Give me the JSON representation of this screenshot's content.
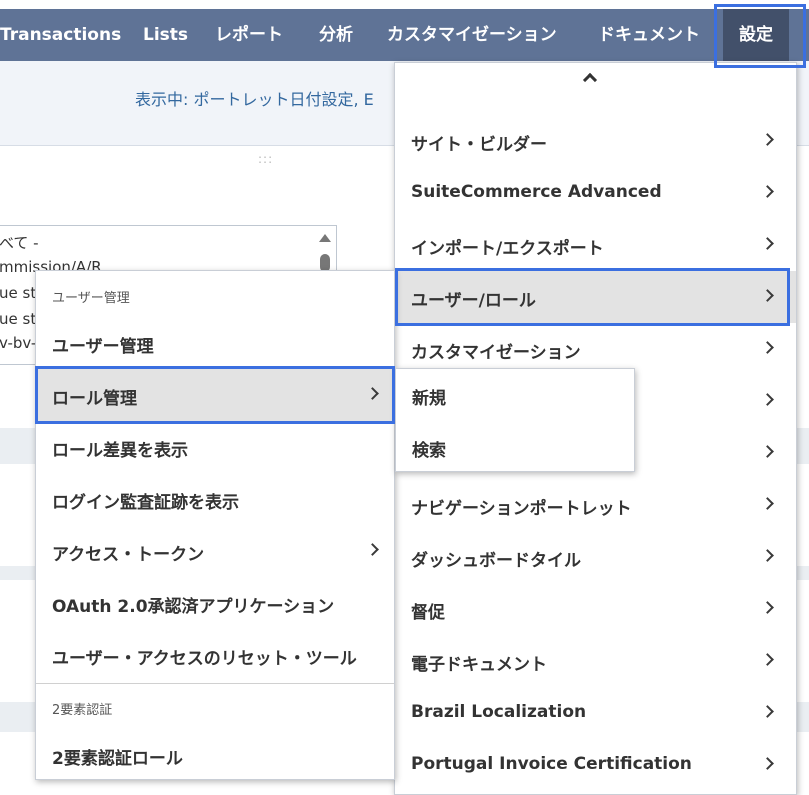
{
  "navbar": {
    "items": [
      "Transactions",
      "Lists",
      "レポート",
      "分析",
      "カスタマイゼーション",
      "ドキュメント"
    ],
    "active": "設定"
  },
  "page": {
    "subbar_text": "表示中: ポートレット日付設定, E",
    "drag_handle": ":::",
    "listbox_lines": [
      "べて -",
      "mmission/A/R",
      "ue st",
      "ue st",
      "v-bv-l"
    ]
  },
  "settings_menu": {
    "items": [
      {
        "label": "サイト・ビルダー"
      },
      {
        "label": "SuiteCommerce Advanced"
      },
      {
        "label": "インポート/エクスポート"
      },
      {
        "label": "ユーザー/ロール"
      },
      {
        "label": "カスタマイゼーション"
      },
      {
        "label": ""
      },
      {
        "label": ""
      },
      {
        "label": "ナビゲーションポートレット"
      },
      {
        "label": "ダッシュボードタイル"
      },
      {
        "label": "督促"
      },
      {
        "label": "電子ドキュメント"
      },
      {
        "label": "Brazil Localization"
      },
      {
        "label": "Portugal Invoice Certification"
      }
    ]
  },
  "user_role_menu": {
    "section1_header": "ユーザー管理",
    "items": [
      {
        "label": "ユーザー管理"
      },
      {
        "label": "ロール管理"
      },
      {
        "label": "ロール差異を表示"
      },
      {
        "label": "ログイン監査証跡を表示"
      },
      {
        "label": "アクセス・トークン"
      },
      {
        "label": "OAuth 2.0承認済アプリケーション"
      },
      {
        "label": "ユーザー・アクセスのリセット・ツール"
      }
    ],
    "section2_header": "2要素認証",
    "section2_items": [
      {
        "label": "2要素認証ロール"
      }
    ]
  },
  "role_submenu": {
    "items": [
      {
        "label": "新規"
      },
      {
        "label": "検索"
      }
    ]
  }
}
